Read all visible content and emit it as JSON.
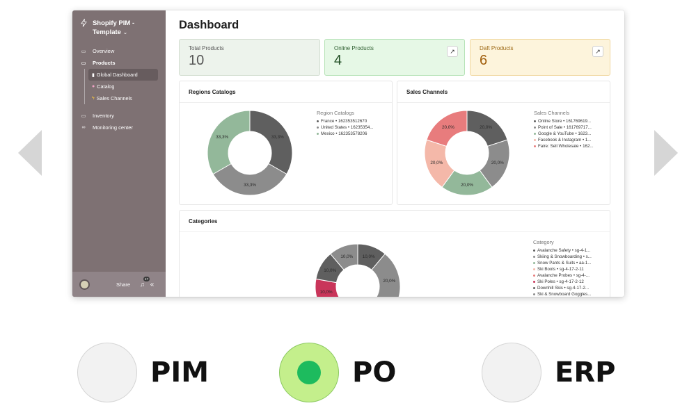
{
  "app": {
    "workspace": "Shopify PIM - Template",
    "workspace_chevron": "⌄"
  },
  "sidebar": {
    "items": [
      {
        "label": "Overview",
        "icon": "folder-icon"
      },
      {
        "label": "Products",
        "icon": "folder-icon"
      }
    ],
    "sub_items": [
      {
        "label": "Global Dashboard",
        "icon": "chart-icon"
      },
      {
        "label": "Catalog",
        "icon": "catalog-icon"
      },
      {
        "label": "Sales Channels",
        "icon": "lightning-icon"
      }
    ],
    "items_bottom": [
      {
        "label": "Inventory",
        "icon": "folder-icon"
      },
      {
        "label": "Monitoring center",
        "icon": "infinity-icon"
      }
    ],
    "footer": {
      "share": "Share",
      "notification_count": "47"
    }
  },
  "main": {
    "title": "Dashboard",
    "stats": {
      "total": {
        "label": "Total Products",
        "value": "10"
      },
      "online": {
        "label": "Online Products",
        "value": "4"
      },
      "daft": {
        "label": "Daft Products",
        "value": "6"
      }
    },
    "regions": {
      "title": "Regions Catalogs",
      "legend_title": "Region Catalogs",
      "legend": [
        {
          "label": "France • 162353512670",
          "color": "#5f5f5f"
        },
        {
          "label": "United States • 16235354...",
          "color": "#8c8c8c"
        },
        {
          "label": "Mexico • 162353578206",
          "color": "#93b89a"
        }
      ]
    },
    "channels": {
      "title": "Sales Channels",
      "legend_title": "Sales Channels",
      "legend": [
        {
          "label": "Online Store • 161769619...",
          "color": "#5f5f5f"
        },
        {
          "label": "Point of Sale • 161769717...",
          "color": "#8c8c8c"
        },
        {
          "label": "Google & YouTube • 1623...",
          "color": "#93b89a"
        },
        {
          "label": "Facebook & Instagram • 1...",
          "color": "#f4b8a9"
        },
        {
          "label": "Faire: Sell Wholesale • 162...",
          "color": "#e87c7d"
        }
      ]
    },
    "categories": {
      "title": "Categories",
      "legend_title": "Category",
      "legend": [
        {
          "label": "Avalanche Safety • sg-4-1...",
          "color": "#5f5f5f"
        },
        {
          "label": "Skiing & Snowboarding • s...",
          "color": "#8c8c8c"
        },
        {
          "label": "Snow Pants & Suits • aa-1...",
          "color": "#93b89a"
        },
        {
          "label": "Ski Boots • sg-4-17-2-11",
          "color": "#f4b8a9"
        },
        {
          "label": "Avalanche Probes • sg-4-...",
          "color": "#e87c7d"
        },
        {
          "label": "Ski Poles • sg-4-17-2-12",
          "color": "#c9355a"
        },
        {
          "label": "Downhill Skis • sg-4-17-2...",
          "color": "#5f5f5f"
        },
        {
          "label": "Ski & Snowboard Goggles...",
          "color": "#8c8c8c"
        }
      ]
    }
  },
  "chart_data": [
    {
      "type": "pie",
      "title": "Regions Catalogs",
      "categories": [
        "France • 162353512670",
        "United States • 16235354...",
        "Mexico • 162353578206"
      ],
      "values": [
        33.3,
        33.3,
        33.3
      ],
      "colors": [
        "#5f5f5f",
        "#8c8c8c",
        "#93b89a"
      ],
      "labels": [
        "33,3%",
        "33,3%",
        "33,3%"
      ]
    },
    {
      "type": "pie",
      "title": "Sales Channels",
      "categories": [
        "Online Store • 161769619...",
        "Point of Sale • 161769717...",
        "Google & YouTube • 1623...",
        "Facebook & Instagram • 1...",
        "Faire: Sell Wholesale • 162..."
      ],
      "values": [
        20,
        20,
        20,
        20,
        20
      ],
      "colors": [
        "#5f5f5f",
        "#8c8c8c",
        "#93b89a",
        "#f4b8a9",
        "#e87c7d"
      ],
      "labels": [
        "20,0%",
        "20,0%",
        "20,0%",
        "20,0%",
        "20,0%"
      ]
    },
    {
      "type": "pie",
      "title": "Categories",
      "categories": [
        "Avalanche Safety • sg-4-1...",
        "Skiing & Snowboarding • s...",
        "Snow Pants & Suits • aa-1...",
        "Ski Boots • sg-4-17-2-11",
        "Avalanche Probes • sg-4-...",
        "Ski Poles • sg-4-17-2-12",
        "Downhill Skis • sg-4-17-2...",
        "Ski & Snowboard Goggles..."
      ],
      "values": [
        10,
        20,
        10,
        10,
        10,
        10,
        10,
        10
      ],
      "colors": [
        "#5f5f5f",
        "#8c8c8c",
        "#93b89a",
        "#f4b8a9",
        "#e87c7d",
        "#c9355a",
        "#5f5f5f",
        "#8c8c8c"
      ],
      "labels": [
        "10,0%",
        "20,0%",
        "",
        "",
        "",
        "10,0%",
        "10,0%",
        "10,0%"
      ]
    }
  ],
  "choices": [
    {
      "label": "PIM",
      "selected": false
    },
    {
      "label": "PO",
      "selected": true
    },
    {
      "label": "ERP",
      "selected": false
    }
  ],
  "colors": {
    "sidebar": "#7e7173",
    "selected_ring": "#c4ef8c",
    "selected_dot": "#1dbb5e"
  }
}
